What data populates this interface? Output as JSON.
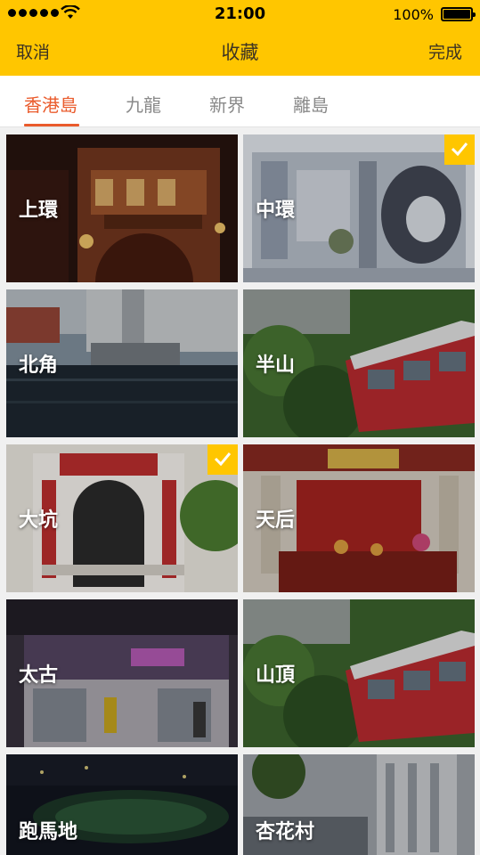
{
  "status_bar": {
    "time": "21:00",
    "battery": "100%"
  },
  "navbar": {
    "cancel_label": "取消",
    "title": "收藏",
    "done_label": "完成"
  },
  "tabs": [
    {
      "label": "香港島",
      "active": true
    },
    {
      "label": "九龍",
      "active": false
    },
    {
      "label": "新界",
      "active": false
    },
    {
      "label": "離島",
      "active": false
    }
  ],
  "tiles": [
    {
      "label": "上環",
      "selected": false
    },
    {
      "label": "中環",
      "selected": true
    },
    {
      "label": "北角",
      "selected": false
    },
    {
      "label": "半山",
      "selected": false
    },
    {
      "label": "大坑",
      "selected": true
    },
    {
      "label": "天后",
      "selected": false
    },
    {
      "label": "太古",
      "selected": false
    },
    {
      "label": "山頂",
      "selected": false
    },
    {
      "label": "跑馬地",
      "selected": false
    },
    {
      "label": "杏花村",
      "selected": false
    }
  ],
  "colors": {
    "accent": "#ffc600",
    "tab_active": "#ea5b2c"
  }
}
